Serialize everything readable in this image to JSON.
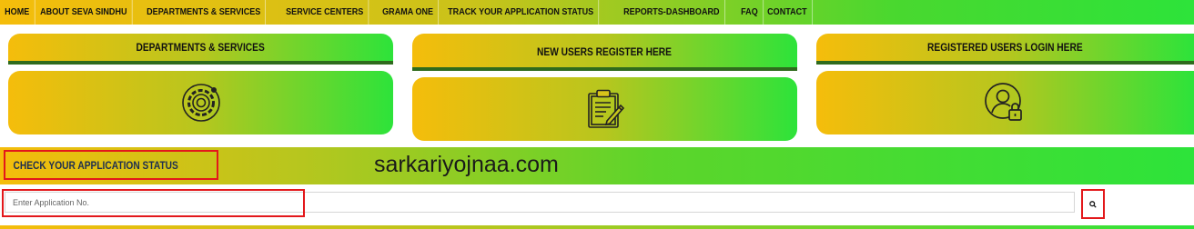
{
  "nav": {
    "items": [
      {
        "label": "HOME"
      },
      {
        "label": "ABOUT SEVA SINDHU"
      },
      {
        "label": "DEPARTMENTS & SERVICES"
      },
      {
        "label": "SERVICE CENTERS"
      },
      {
        "label": "GRAMA ONE"
      },
      {
        "label": "TRACK YOUR APPLICATION STATUS"
      },
      {
        "label": "REPORTS-DASHBOARD"
      },
      {
        "label": "FAQ"
      },
      {
        "label": "CONTACT"
      }
    ]
  },
  "cards": {
    "departments": {
      "title": "DEPARTMENTS & SERVICES",
      "icon": "gear-icon"
    },
    "register": {
      "title": "NEW USERS REGISTER HERE",
      "icon": "clipboard-edit-icon"
    },
    "login": {
      "title": "REGISTERED USERS LOGIN HERE",
      "icon": "user-lock-icon"
    }
  },
  "status": {
    "label": "CHECK YOUR APPLICATION STATUS",
    "watermark": "sarkariyojnaa.com",
    "input_placeholder": "Enter Application No.",
    "search_icon": "search-icon"
  },
  "colors": {
    "gradient_start": "#f5bd0b",
    "gradient_end": "#2de33a",
    "highlight_red": "#e3181b",
    "header_underline": "#2f6b1d"
  }
}
